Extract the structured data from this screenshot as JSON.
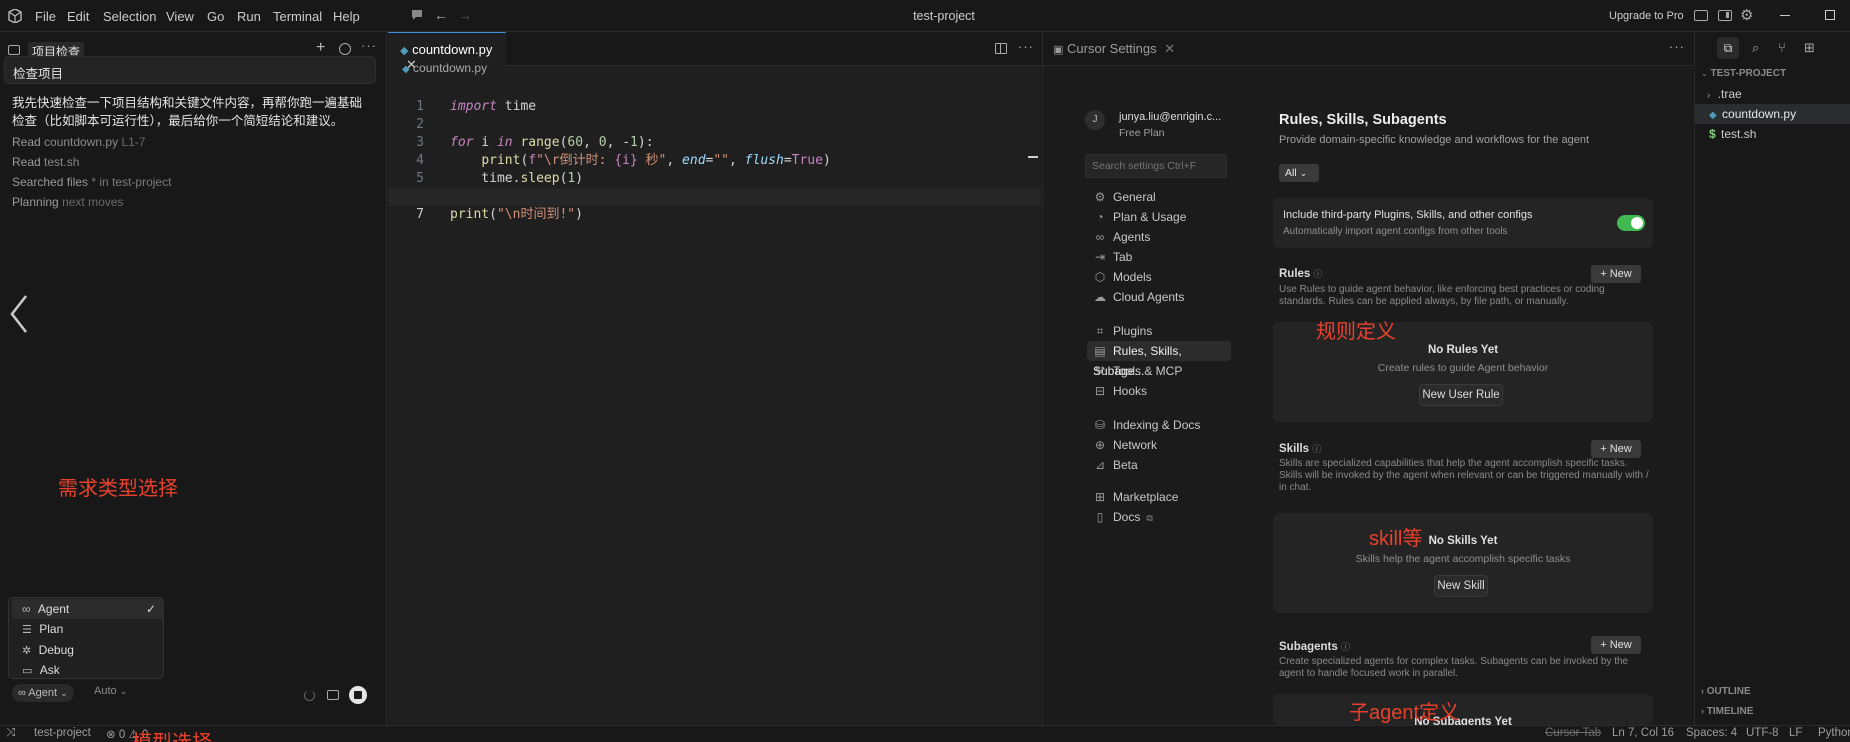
{
  "titlebar": {
    "menus": [
      "File",
      "Edit",
      "Selection",
      "View",
      "Go",
      "Run",
      "Terminal",
      "Help"
    ],
    "title": "test-project",
    "upgrade": "Upgrade to Pro"
  },
  "chat": {
    "tab_title": "项目检查",
    "query": "检查项目",
    "response": "我先快速检查一下项目结构和关键文件内容，再帮你跑一遍基础检查（比如脚本可运行性），最后给你一个简短结论和建议。",
    "steps": [
      {
        "verb": "Read",
        "target": "countdown.py",
        "extra": "L1-7"
      },
      {
        "verb": "Read",
        "target": "test.sh",
        "extra": ""
      },
      {
        "verb": "Searched files",
        "target": "* in test-project",
        "extra": ""
      },
      {
        "verb": "Planning",
        "target": "next moves",
        "extra": ""
      }
    ],
    "annotation_mode": "需求类型选择",
    "annotation_model": "模型选择",
    "modes": [
      {
        "label": "Agent",
        "icon": "infinity-icon",
        "checked": true
      },
      {
        "label": "Plan",
        "icon": "list-icon",
        "checked": false
      },
      {
        "label": "Debug",
        "icon": "bug-icon",
        "checked": false
      },
      {
        "label": "Ask",
        "icon": "chat-icon",
        "checked": false
      }
    ],
    "mode_selected": "Agent",
    "model_selected": "Auto"
  },
  "editor": {
    "tab": "countdown.py",
    "breadcrumb": "countdown.py",
    "cursor_line": 7
  },
  "settings": {
    "tab": "Cursor Settings",
    "user_email": "junya.liu@enrigin.c...",
    "user_plan": "Free Plan",
    "avatar_letter": "J",
    "search_placeholder": "Search settings Ctrl+F",
    "nav_group1": [
      {
        "label": "General",
        "icon": "gear-icon"
      },
      {
        "label": "Plan & Usage",
        "icon": "plan-icon"
      },
      {
        "label": "Agents",
        "icon": "infinity-icon"
      },
      {
        "label": "Tab",
        "icon": "tab-icon"
      },
      {
        "label": "Models",
        "icon": "cube-icon"
      },
      {
        "label": "Cloud Agents",
        "icon": "cloud-icon"
      }
    ],
    "nav_group2": [
      {
        "label": "Plugins",
        "icon": "plugin-icon"
      },
      {
        "label": "Rules, Skills, Subage...",
        "icon": "book-icon",
        "active": true
      },
      {
        "label": "Tools & MCP",
        "icon": "tools-icon"
      },
      {
        "label": "Hooks",
        "icon": "hooks-icon"
      }
    ],
    "nav_group3": [
      {
        "label": "Indexing & Docs",
        "icon": "database-icon"
      },
      {
        "label": "Network",
        "icon": "globe-icon"
      },
      {
        "label": "Beta",
        "icon": "beta-icon"
      }
    ],
    "nav_group4": [
      {
        "label": "Marketplace",
        "icon": "marketplace-icon"
      },
      {
        "label": "Docs",
        "icon": "docs-icon"
      }
    ],
    "page_title": "Rules, Skills, Subagents",
    "page_subtitle": "Provide domain-specific knowledge and workflows for the agent",
    "filter": "All",
    "toggle_title": "Include third-party Plugins, Skills, and other configs",
    "toggle_desc": "Automatically import agent configs from other tools",
    "toggle_on": true,
    "new_label": "New",
    "rules": {
      "title": "Rules",
      "desc": "Use Rules to guide agent behavior, like enforcing best practices or coding standards. Rules can be applied always, by file path, or manually.",
      "empty_title": "No Rules Yet",
      "empty_desc": "Create rules to guide Agent behavior",
      "button": "New User Rule",
      "annotation": "规则定义"
    },
    "skills": {
      "title": "Skills",
      "desc": "Skills are specialized capabilities that help the agent accomplish specific tasks. Skills will be invoked by the agent when relevant or can be triggered manually with / in chat.",
      "empty_title": "No Skills Yet",
      "empty_desc": "Skills help the agent accomplish specific tasks",
      "button": "New Skill",
      "annotation": "skill等"
    },
    "subagents": {
      "title": "Subagents",
      "desc": "Create specialized agents for complex tasks. Subagents can be invoked by the agent to handle focused work in parallel.",
      "annotation": "子agent定义",
      "empty_title": "No Subagents Yet"
    }
  },
  "explorer": {
    "project": "TEST-PROJECT",
    "items": [
      {
        "label": ".trae",
        "type": "folder"
      },
      {
        "label": "countdown.py",
        "type": "py",
        "active": true
      },
      {
        "label": "test.sh",
        "type": "sh"
      }
    ],
    "outline": "OUTLINE",
    "timeline": "TIMELINE"
  },
  "statusbar": {
    "project": "test-project",
    "errors": "0",
    "warnings": "0",
    "cursor_tab": "Cursor Tab",
    "position": "Ln 7, Col 16",
    "spaces": "Spaces: 4",
    "encoding": "UTF-8",
    "eol": "LF",
    "language": "Python"
  }
}
